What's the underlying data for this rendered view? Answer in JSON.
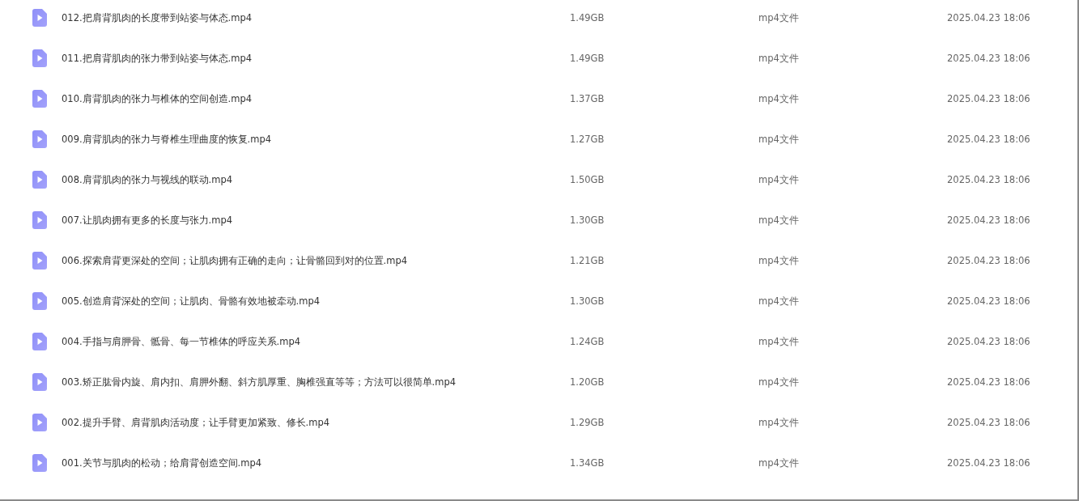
{
  "files": [
    {
      "name": "012.把肩背肌肉的长度带到站姿与体态.mp4",
      "size": "1.49GB",
      "type": "mp4文件",
      "modified": "2025.04.23 18:06"
    },
    {
      "name": "011.把肩背肌肉的张力带到站姿与体态.mp4",
      "size": "1.49GB",
      "type": "mp4文件",
      "modified": "2025.04.23 18:06"
    },
    {
      "name": "010.肩背肌肉的张力与椎体的空间创造.mp4",
      "size": "1.37GB",
      "type": "mp4文件",
      "modified": "2025.04.23 18:06"
    },
    {
      "name": "009.肩背肌肉的张力与脊椎生理曲度的恢复.mp4",
      "size": "1.27GB",
      "type": "mp4文件",
      "modified": "2025.04.23 18:06"
    },
    {
      "name": "008.肩背肌肉的张力与视线的联动.mp4",
      "size": "1.50GB",
      "type": "mp4文件",
      "modified": "2025.04.23 18:06"
    },
    {
      "name": "007.让肌肉拥有更多的长度与张力.mp4",
      "size": "1.30GB",
      "type": "mp4文件",
      "modified": "2025.04.23 18:06"
    },
    {
      "name": "006.探索肩背更深处的空间；让肌肉拥有正确的走向；让骨骼回到对的位置.mp4",
      "size": "1.21GB",
      "type": "mp4文件",
      "modified": "2025.04.23 18:06"
    },
    {
      "name": "005.创造肩背深处的空间；让肌肉、骨骼有效地被牵动.mp4",
      "size": "1.30GB",
      "type": "mp4文件",
      "modified": "2025.04.23 18:06"
    },
    {
      "name": "004.手指与肩胛骨、骶骨、每一节椎体的呼应关系.mp4",
      "size": "1.24GB",
      "type": "mp4文件",
      "modified": "2025.04.23 18:06"
    },
    {
      "name": "003.矫正肱骨内旋、肩内扣、肩胛外翻、斜方肌厚重、胸椎强直等等；方法可以很简单.mp4",
      "size": "1.20GB",
      "type": "mp4文件",
      "modified": "2025.04.23 18:06"
    },
    {
      "name": "002.提升手臂、肩背肌肉活动度；让手臂更加紧致、修长.mp4",
      "size": "1.29GB",
      "type": "mp4文件",
      "modified": "2025.04.23 18:06"
    },
    {
      "name": "001.关节与肌肉的松动；给肩背创造空间.mp4",
      "size": "1.34GB",
      "type": "mp4文件",
      "modified": "2025.04.23 18:06"
    }
  ]
}
